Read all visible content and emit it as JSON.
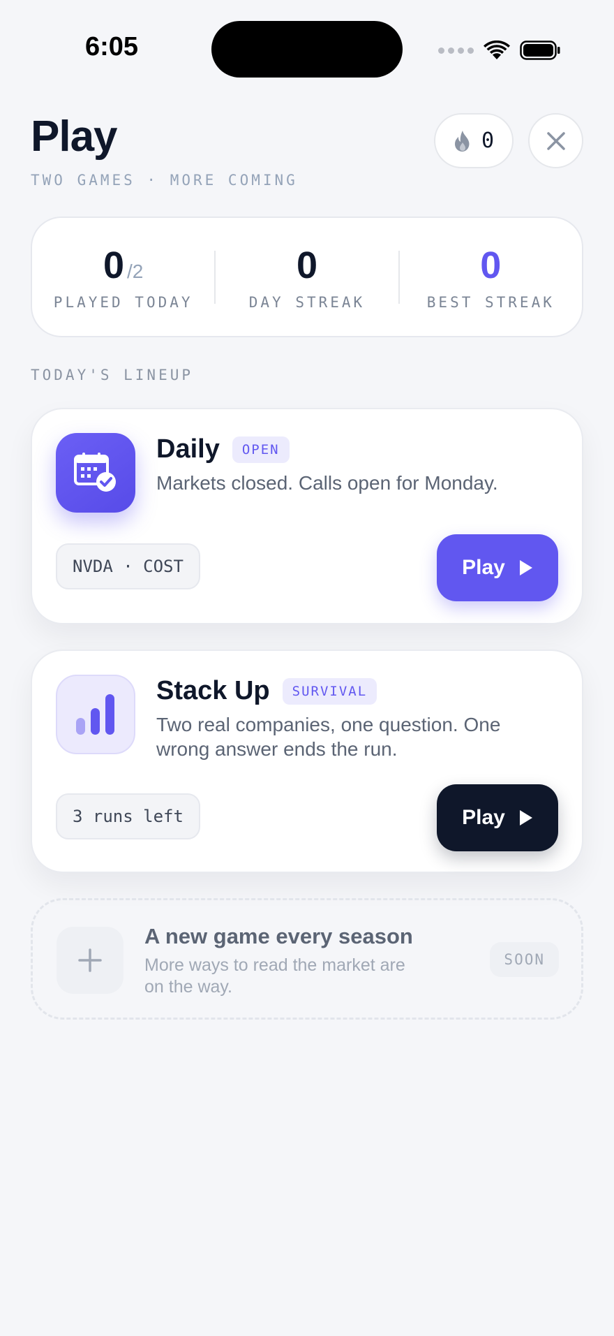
{
  "status_bar": {
    "time": "6:05",
    "icons": [
      "cellular-icon",
      "wifi-icon",
      "battery-icon"
    ]
  },
  "header": {
    "title": "Play",
    "subtitle": "TWO GAMES · MORE COMING",
    "streak_count": "0",
    "streak_icon": "flame-icon",
    "close_icon": "close-icon"
  },
  "stats": [
    {
      "value": "0",
      "sub": "/2",
      "label": "PLAYED TODAY"
    },
    {
      "value": "0",
      "label": "DAY STREAK"
    },
    {
      "value": "0",
      "label": "BEST STREAK"
    }
  ],
  "lineup": {
    "label": "TODAY'S LINEUP",
    "games": [
      {
        "name": "Daily",
        "badge": "OPEN",
        "description": "Markets closed. Calls open for Monday.",
        "chip": "NVDA · COST",
        "play_label": "Play",
        "icon": "calendar-check-icon"
      },
      {
        "name": "Stack Up",
        "badge": "SURVIVAL",
        "description": "Two real companies, one question. One wrong answer ends the run.",
        "chip": "3 runs left",
        "play_label": "Play",
        "icon": "bar-chart-icon"
      }
    ]
  },
  "coming_soon": {
    "title": "A new game every season",
    "description": "More ways to read the market are on the way.",
    "badge": "SOON",
    "icon": "plus-icon"
  },
  "colors": {
    "accent": "#6157f0",
    "dark": "#0f172a",
    "background": "#f5f6f9",
    "muted": "#94a3b8"
  }
}
